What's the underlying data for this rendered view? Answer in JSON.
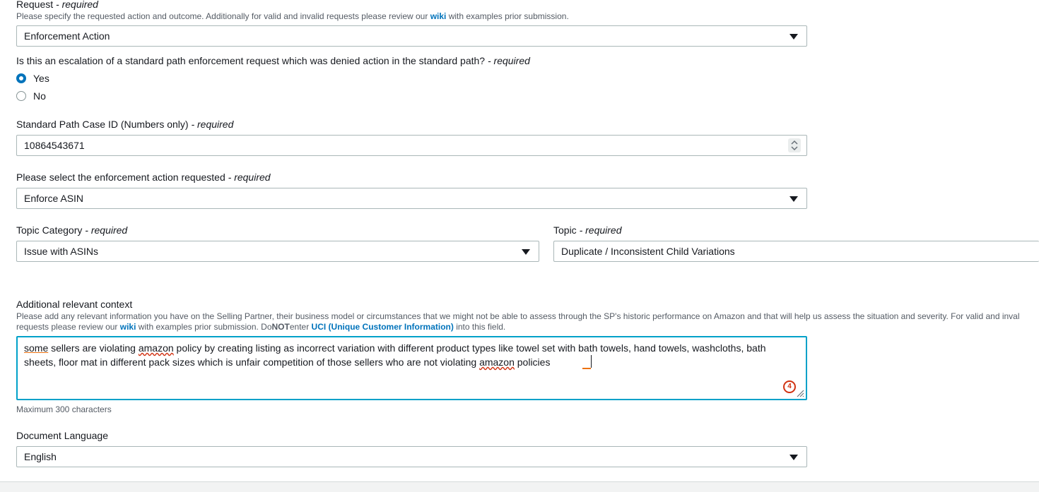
{
  "request": {
    "label": "Request",
    "required": "- required",
    "hint_before": "Please specify the requested action and outcome. Additionally for valid and invalid requests please review our ",
    "hint_link": "wiki",
    "hint_after": " with examples prior submission.",
    "value": "Enforcement Action"
  },
  "escalation": {
    "question": "Is this an escalation of a standard path enforcement request which was denied action in the standard path?",
    "required": "- required",
    "options": [
      "Yes",
      "No"
    ],
    "selected": "Yes"
  },
  "case_id": {
    "label": "Standard Path Case ID (Numbers only)",
    "required": "- required",
    "value": "10864543671"
  },
  "enforcement": {
    "label": "Please select the enforcement action requested",
    "required": "- required",
    "value": "Enforce ASIN"
  },
  "topic_category": {
    "label": "Topic Category",
    "required": "- required",
    "value": "Issue with ASINs"
  },
  "topic": {
    "label": "Topic",
    "required": "- required",
    "value": "Duplicate / Inconsistent Child Variations"
  },
  "context": {
    "label": "Additional relevant context",
    "hint_line1": "Please add any relevant information you have on the Selling Partner, their business model or circumstances that we might not be able to assess through the SP's historic performance on Amazon and that will help us assess the situation and severity. For valid and inval",
    "hint_line2_a": "requests please review our ",
    "hint_line2_link": "wiki",
    "hint_line2_b": " with examples prior submission. Do",
    "hint_not": "NOT",
    "hint_line2_c": "enter ",
    "hint_uci": "UCI (Unique Customer Information)",
    "hint_line2_d": " into this field.",
    "text_parts": [
      "some",
      " sellers are violating ",
      "amazon",
      " policy by creating listing as incorrect variation with different product types like towel set with bath towels, hand towels, washcloths, bath sheets, floor mat in different pack sizes which is unfair competition of those sellers who are not violating ",
      "amazon",
      " policies"
    ],
    "error_count": "4",
    "max_chars": "Maximum 300 characters"
  },
  "language": {
    "label": "Document Language",
    "value": "English"
  },
  "colors": {
    "link": "#0073bb",
    "focus": "#00a1c9",
    "radio_selected": "#0073bb",
    "error": "#d13212"
  },
  "icons": [
    "chevron-down-icon",
    "number-spinner-icon",
    "error-count-icon",
    "resize-handle-icon"
  ]
}
